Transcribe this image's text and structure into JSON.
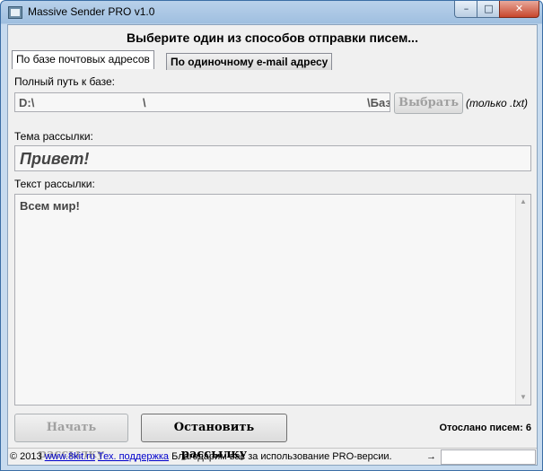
{
  "window": {
    "title": "Massive Sender PRO v1.0",
    "controls": {
      "minimize": "–",
      "maximize": "□",
      "close": "✕"
    }
  },
  "heading": "Выберите один из способов отправки писем...",
  "tabs": [
    {
      "label": "По базе почтовых адресов",
      "active": true
    },
    {
      "label": "По одиночному e-mail адресу",
      "active": false
    }
  ],
  "db": {
    "label": "Полный путь к базе:",
    "path_segments": [
      "D:\\",
      "\\",
      "\\Базы"
    ],
    "choose_button": "Выбрать",
    "hint": "(только .txt)"
  },
  "subject": {
    "label": "Тема рассылки:",
    "value": "Привет!"
  },
  "body": {
    "label": "Текст рассылки:",
    "value": "Всем мир!"
  },
  "actions": {
    "start_button": "Начать рассылку",
    "stop_button": "Остановить рассылку",
    "sent_count_text": "Отослано писем: 6"
  },
  "status": {
    "copyright": "© 2013",
    "site_link": "www.8kit.ru",
    "support_link": "Тех. поддержка",
    "thanks_text": "Благодарим вас за использование PRO-версии.",
    "arrow": "→"
  }
}
